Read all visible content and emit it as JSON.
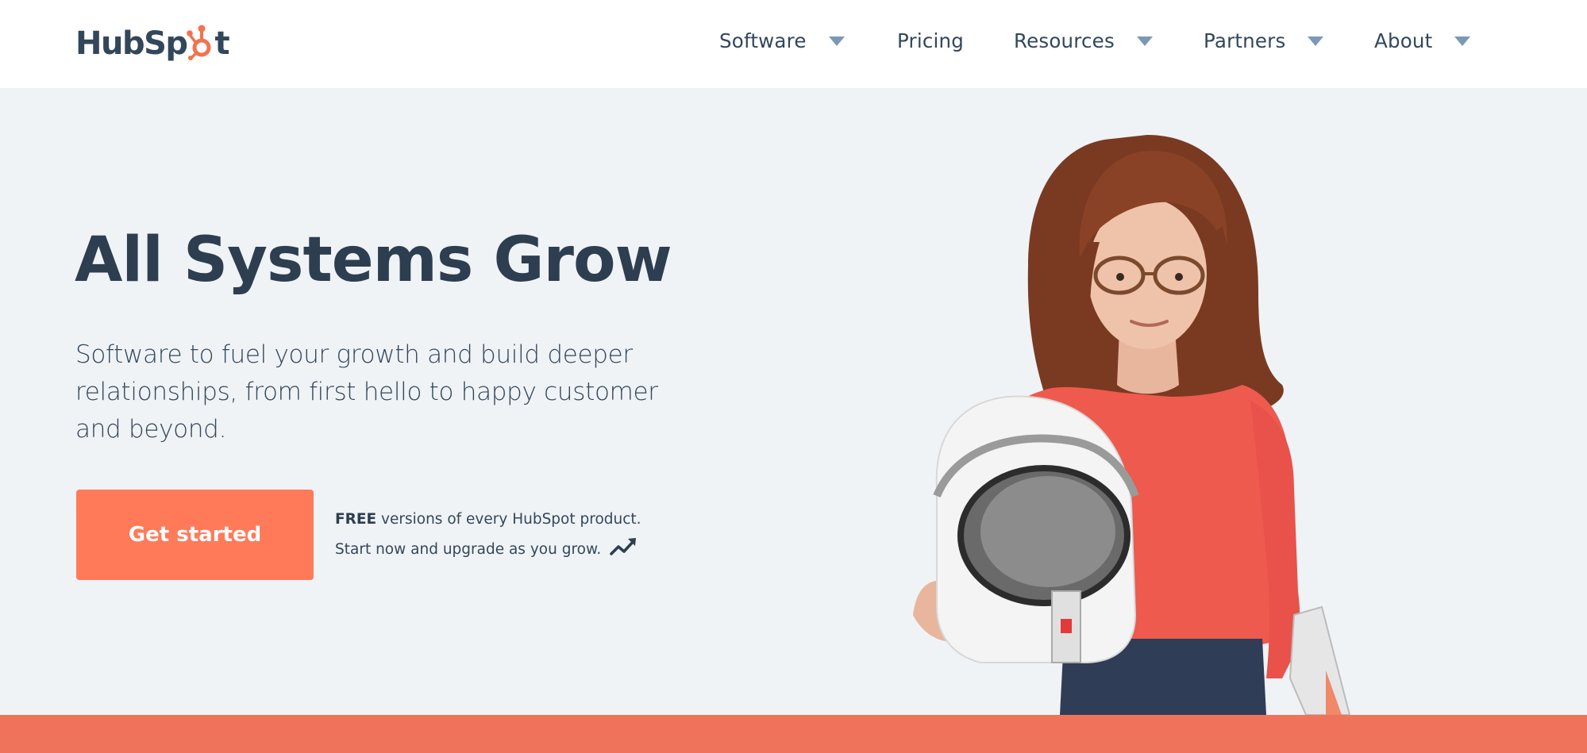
{
  "header": {
    "logo_text_left": "HubSp",
    "logo_text_right": "t",
    "logo_icon": "sprocket-icon",
    "nav": [
      {
        "label": "Software",
        "has_dropdown": true
      },
      {
        "label": "Pricing",
        "has_dropdown": false
      },
      {
        "label": "Resources",
        "has_dropdown": true
      },
      {
        "label": "Partners",
        "has_dropdown": true
      },
      {
        "label": "About",
        "has_dropdown": true
      }
    ]
  },
  "hero": {
    "title": "All Systems Grow",
    "subtitle": "Software to fuel your growth and build deeper relationships, from first hello to happy customer and beyond.",
    "cta_label": "Get started",
    "note_bold": "FREE",
    "note_line1_rest": " versions of every HubSpot product.",
    "note_line2": "Start now and upgrade as you grow.",
    "note_icon": "trending-up-icon",
    "image_alt": "Woman in red sweater holding an astronaut helmet"
  },
  "colors": {
    "brand_orange": "#ff7a59",
    "logo_orange": "#f2734f",
    "text_dark": "#2d3e50",
    "caret": "#7c98b6",
    "hero_bg": "#f0f3f6",
    "bottom_bar": "#ef735a"
  }
}
